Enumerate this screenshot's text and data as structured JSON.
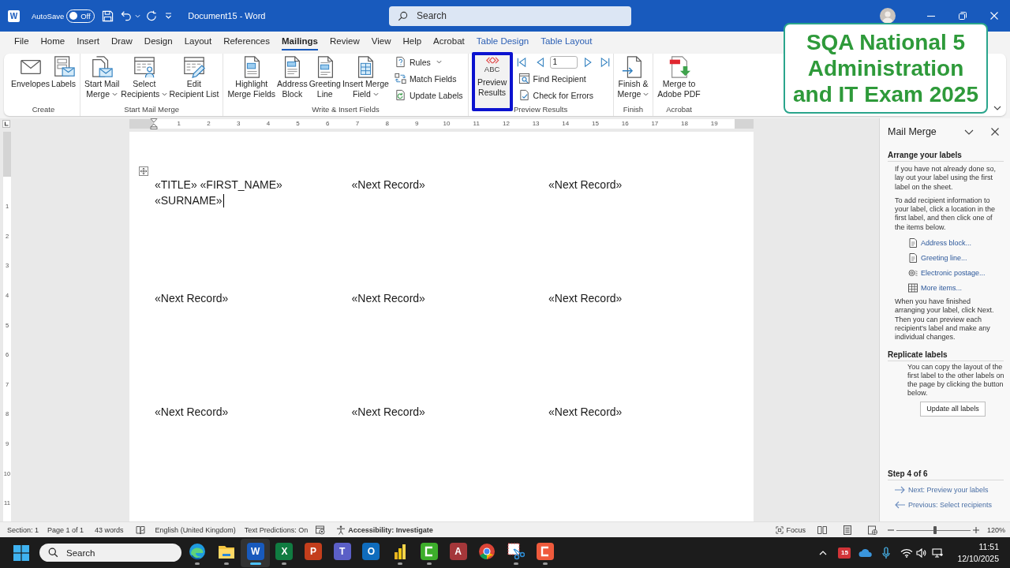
{
  "title_bar": {
    "app_logo": "W",
    "autosave_label": "AutoSave",
    "autosave_toggle": {
      "on": false,
      "label": "Off"
    },
    "document_title": "Document15 - Word",
    "search": {
      "placeholder": "Search"
    }
  },
  "menu_tabs": [
    {
      "label": "File",
      "selected": false,
      "kind": "standard"
    },
    {
      "label": "Home",
      "selected": false,
      "kind": "standard"
    },
    {
      "label": "Insert",
      "selected": false,
      "kind": "standard"
    },
    {
      "label": "Draw",
      "selected": false,
      "kind": "standard"
    },
    {
      "label": "Design",
      "selected": false,
      "kind": "standard"
    },
    {
      "label": "Layout",
      "selected": false,
      "kind": "standard"
    },
    {
      "label": "References",
      "selected": false,
      "kind": "standard"
    },
    {
      "label": "Mailings",
      "selected": true,
      "kind": "standard"
    },
    {
      "label": "Review",
      "selected": false,
      "kind": "standard"
    },
    {
      "label": "View",
      "selected": false,
      "kind": "standard"
    },
    {
      "label": "Help",
      "selected": false,
      "kind": "standard"
    },
    {
      "label": "Acrobat",
      "selected": false,
      "kind": "standard"
    },
    {
      "label": "Table Design",
      "selected": false,
      "kind": "contextual"
    },
    {
      "label": "Table Layout",
      "selected": false,
      "kind": "contextual"
    }
  ],
  "ribbon": {
    "groups": [
      {
        "label": "Create",
        "items": [
          {
            "kind": "large",
            "lines": [
              "Envelopes"
            ],
            "dropdown": false,
            "highlighted": false
          },
          {
            "kind": "large",
            "lines": [
              "Labels"
            ],
            "dropdown": false,
            "highlighted": false
          }
        ]
      },
      {
        "label": "Start Mail Merge",
        "items": [
          {
            "kind": "large",
            "lines": [
              "Start Mail",
              "Merge"
            ],
            "dropdown": true,
            "highlighted": false
          },
          {
            "kind": "large",
            "lines": [
              "Select",
              "Recipients"
            ],
            "dropdown": true,
            "highlighted": false
          },
          {
            "kind": "large",
            "lines": [
              "Edit",
              "Recipient List"
            ],
            "dropdown": false,
            "highlighted": false
          }
        ]
      },
      {
        "label": "Write & Insert Fields",
        "items": [
          {
            "kind": "large",
            "lines": [
              "Highlight",
              "Merge Fields"
            ],
            "dropdown": false,
            "highlighted": false
          },
          {
            "kind": "large",
            "lines": [
              "Address",
              "Block"
            ],
            "dropdown": false,
            "highlighted": false
          },
          {
            "kind": "large",
            "lines": [
              "Greeting",
              "Line"
            ],
            "dropdown": false,
            "highlighted": false
          },
          {
            "kind": "large",
            "lines": [
              "Insert Merge",
              "Field"
            ],
            "dropdown": true,
            "highlighted": false
          },
          {
            "kind": "stack",
            "buttons": [
              {
                "label": "Rules",
                "dropdown": true
              },
              {
                "label": "Match Fields",
                "dropdown": false
              },
              {
                "label": "Update Labels",
                "dropdown": false
              }
            ]
          }
        ]
      },
      {
        "label": "Preview Results",
        "items": [
          {
            "kind": "large",
            "icon_caption": "ABC",
            "lines": [
              "Preview",
              "Results"
            ],
            "dropdown": false,
            "highlighted": true
          },
          {
            "kind": "navigator",
            "record": "1",
            "buttons": [
              {
                "label": "Find Recipient",
                "dropdown": false
              },
              {
                "label": "Check for Errors",
                "dropdown": false
              }
            ]
          }
        ]
      },
      {
        "label": "Finish",
        "items": [
          {
            "kind": "large",
            "lines": [
              "Finish &",
              "Merge"
            ],
            "dropdown": true,
            "highlighted": false
          }
        ]
      },
      {
        "label": "Acrobat",
        "items": [
          {
            "kind": "large",
            "lines": [
              "Merge to",
              "Adobe PDF"
            ],
            "dropdown": false,
            "highlighted": false
          }
        ]
      }
    ]
  },
  "overlay_banner": {
    "lines": [
      "SQA National 5",
      "Administration",
      "and IT Exam 2025"
    ]
  },
  "ruler": {
    "horizontal": [
      "1",
      "2",
      "3",
      "4",
      "5",
      "6",
      "7",
      "8",
      "9",
      "10",
      "11",
      "12",
      "13",
      "14",
      "15",
      "16",
      "17",
      "18",
      "19"
    ],
    "vertical": [
      "1",
      "2",
      "3",
      "4",
      "5",
      "6",
      "7",
      "8",
      "9",
      "10",
      "11"
    ]
  },
  "document": {
    "label_rows": [
      {
        "cells": [
          {
            "lines": [
              "«TITLE» «FIRST_NAME»",
              "«SURNAME»"
            ],
            "cursor": true
          },
          {
            "lines": [
              "«Next Record»"
            ],
            "cursor": false
          },
          {
            "lines": [
              "«Next Record»"
            ],
            "cursor": false
          }
        ]
      },
      {
        "cells": [
          {
            "lines": [
              "«Next Record»"
            ],
            "cursor": false
          },
          {
            "lines": [
              "«Next Record»"
            ],
            "cursor": false
          },
          {
            "lines": [
              "«Next Record»"
            ],
            "cursor": false
          }
        ]
      },
      {
        "cells": [
          {
            "lines": [
              "«Next Record»"
            ],
            "cursor": false
          },
          {
            "lines": [
              "«Next Record»"
            ],
            "cursor": false
          },
          {
            "lines": [
              "«Next Record»"
            ],
            "cursor": false
          }
        ]
      }
    ]
  },
  "mail_merge_pane": {
    "title": "Mail Merge",
    "arrange": {
      "heading": "Arrange your labels",
      "intro": "If you have not already done so, lay out your label using the first label on the sheet.",
      "instruction": "To add recipient information to your label, click a location in the first label, and then click one of the items below.",
      "links": [
        "Address block...",
        "Greeting line...",
        "Electronic postage...",
        "More items..."
      ],
      "after": "When you have finished arranging your label, click Next. Then you can preview each recipient's label and make any individual changes."
    },
    "replicate": {
      "heading": "Replicate labels",
      "text": "You can copy the layout of the first label to the other labels on the page by clicking the button below.",
      "button": "Update all labels"
    },
    "step": {
      "heading": "Step 4 of 6",
      "links": [
        {
          "kind": "next",
          "label": "Next: Preview your labels"
        },
        {
          "kind": "previous",
          "label": "Previous: Select recipients"
        }
      ]
    }
  },
  "status_bar": {
    "section": "Section: 1",
    "page": "Page 1 of 1",
    "words": "43 words",
    "language": "English (United Kingdom)",
    "text_predictions": "Text Predictions: On",
    "accessibility": "Accessibility: Investigate",
    "focus": "Focus",
    "zoom": {
      "level": 0.52,
      "reading": "120%"
    }
  },
  "taskbar": {
    "search": {
      "placeholder": "Search"
    },
    "apps": [
      {
        "kind": "picture",
        "running": true,
        "selected": false
      },
      {
        "kind": "picture",
        "running": true,
        "selected": false
      },
      {
        "kind": "letter",
        "glyph": "W",
        "color": "#185abd",
        "running": true,
        "selected": true
      },
      {
        "kind": "letter",
        "glyph": "X",
        "color": "#107c41",
        "running": true,
        "selected": false
      },
      {
        "kind": "letter",
        "glyph": "P",
        "color": "#c43e1c",
        "running": false,
        "selected": false
      },
      {
        "kind": "letter",
        "glyph": "T",
        "color": "#5b5fc7",
        "running": false,
        "selected": false
      },
      {
        "kind": "letter",
        "glyph": "O",
        "color": "#0f6cbd",
        "running": false,
        "selected": false
      },
      {
        "kind": "picture",
        "running": true,
        "selected": false
      },
      {
        "kind": "picture",
        "running": true,
        "selected": false
      },
      {
        "kind": "letter",
        "glyph": "A",
        "color": "#a4373a",
        "running": false,
        "selected": false
      },
      {
        "kind": "picture",
        "running": false,
        "selected": false
      },
      {
        "kind": "picture",
        "running": true,
        "selected": false
      },
      {
        "kind": "picture",
        "running": true,
        "selected": false
      }
    ],
    "tray": {
      "calendar_badge": "15",
      "time": "11:51",
      "date": "12/10/2025"
    }
  }
}
